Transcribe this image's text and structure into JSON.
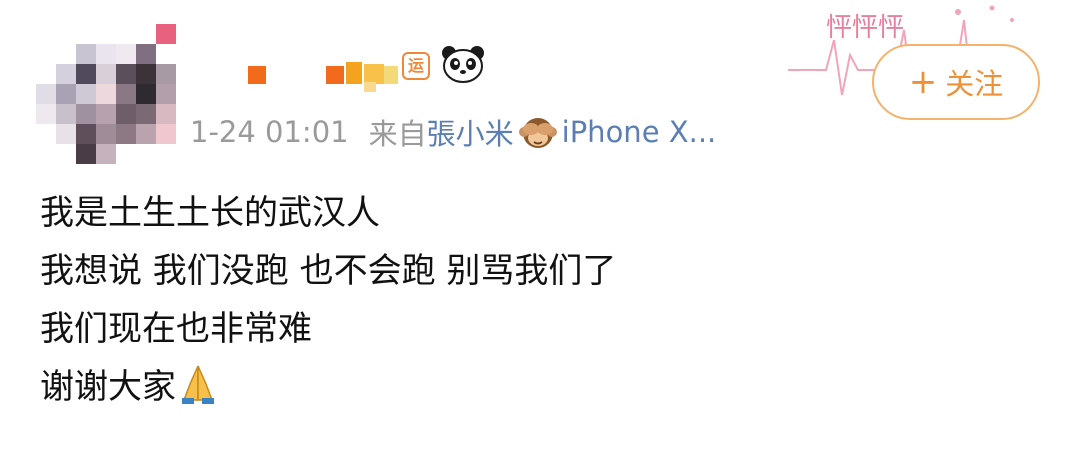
{
  "post": {
    "meta": {
      "time": "1-24 01:01",
      "source_prefix": "来自",
      "source_name": "張小米",
      "client": "iPhone X..."
    },
    "lines": [
      "我是土生土长的武汉人",
      "我想说 我们没跑 也不会跑 别骂我们了",
      "我们现在也非常难",
      "谢谢大家"
    ],
    "icons": {
      "badge": "vip-badge-icon",
      "panda": "panda-icon",
      "monkey": "see-no-evil-monkey-icon",
      "pray": "folded-hands-icon"
    },
    "vip_badge_char": "运"
  },
  "follow": {
    "plus": "+",
    "label": "关注"
  },
  "decoration": {
    "text": "怦怦怦"
  },
  "colors": {
    "accent": "#f09036",
    "meta_gray": "#9a9a9a",
    "client_blue": "#5b7fb5"
  }
}
